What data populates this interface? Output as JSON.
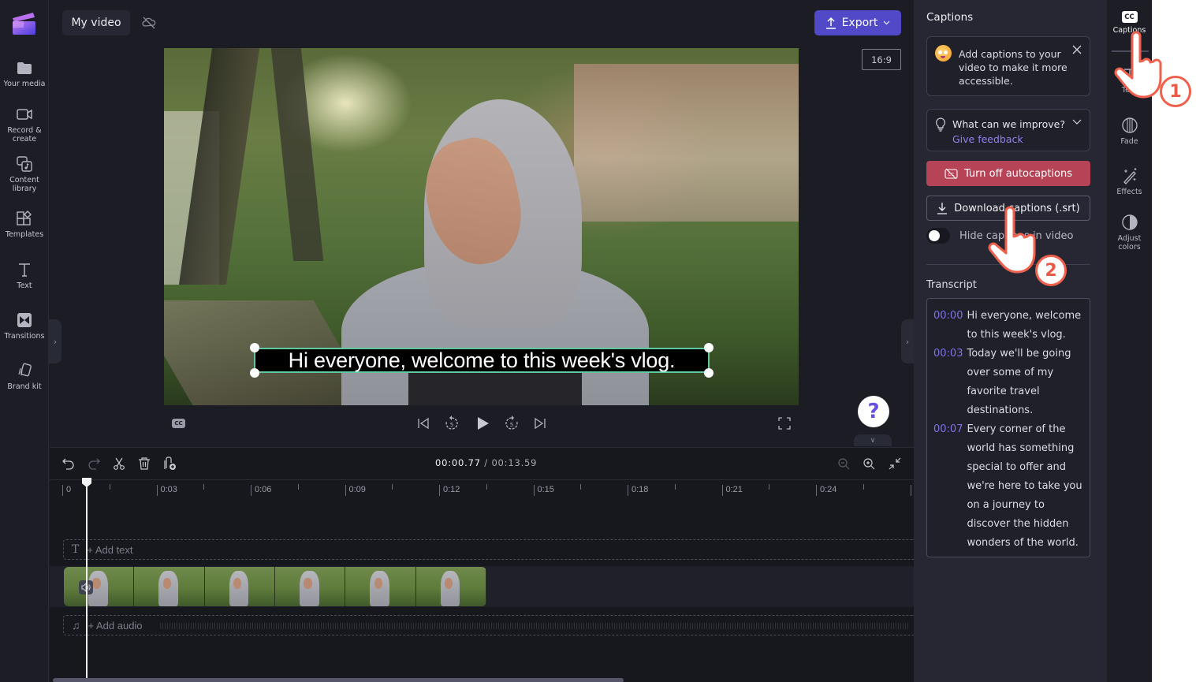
{
  "app": {
    "project_title": "My video",
    "export_label": "Export",
    "aspect_ratio": "16:9"
  },
  "left_rail": {
    "items": [
      {
        "label": "Your media",
        "icon": "folder-icon"
      },
      {
        "label": "Record & create",
        "icon": "video-camera-icon"
      },
      {
        "label": "Content library",
        "icon": "content-library-icon"
      },
      {
        "label": "Templates",
        "icon": "templates-icon"
      },
      {
        "label": "Text",
        "icon": "text-icon"
      },
      {
        "label": "Transitions",
        "icon": "transitions-icon"
      },
      {
        "label": "Brand kit",
        "icon": "brand-kit-icon"
      }
    ]
  },
  "preview": {
    "caption_text": "Hi everyone, welcome to this week's vlog.",
    "cc_label": "CC",
    "help_label": "?"
  },
  "timeline": {
    "current_time": "00:00.77",
    "separator": " / ",
    "total_time": "00:13.59",
    "ruler_labels": [
      "0",
      "0:03",
      "0:06",
      "0:09",
      "0:12",
      "0:15",
      "0:18",
      "0:21",
      "0:24"
    ],
    "add_text_label": "+ Add text",
    "add_audio_label": "+ Add audio"
  },
  "captions_panel": {
    "title": "Captions",
    "tip_text": "Add captions to your video to make it more accessible.",
    "feedback_question": "What can we improve?",
    "feedback_link": "Give feedback",
    "turn_off_label": "Turn off autocaptions",
    "download_label": "Download captions (.srt)",
    "hide_toggle_label": "Hide captions in video",
    "hide_toggle_on": false,
    "transcript_title": "Transcript",
    "transcript": [
      {
        "time": "00:00",
        "text": "Hi everyone, welcome to this week's vlog."
      },
      {
        "time": "00:03",
        "text": "Today we'll be going over some of my favorite travel destinations."
      },
      {
        "time": "00:07",
        "text": "Every corner of the world has something special to offer and we're here to take you on a journey to discover the hidden wonders of the world."
      }
    ]
  },
  "tool_rail": {
    "items": [
      {
        "label": "Captions",
        "icon": "closed-captions-icon",
        "active": true
      },
      {
        "label": "Text",
        "icon": "text-icon"
      },
      {
        "label": "Fade",
        "icon": "fade-icon"
      },
      {
        "label": "Effects",
        "icon": "magic-wand-icon"
      },
      {
        "label": "Adjust colors",
        "icon": "contrast-icon"
      }
    ]
  },
  "annotations": {
    "step_1": "1",
    "step_2": "2"
  },
  "colors": {
    "accent": "#5249c9",
    "danger": "#b64356",
    "link": "#8f83f0",
    "caption_border": "#5ec9a0",
    "step_badge": "#f0614d"
  }
}
